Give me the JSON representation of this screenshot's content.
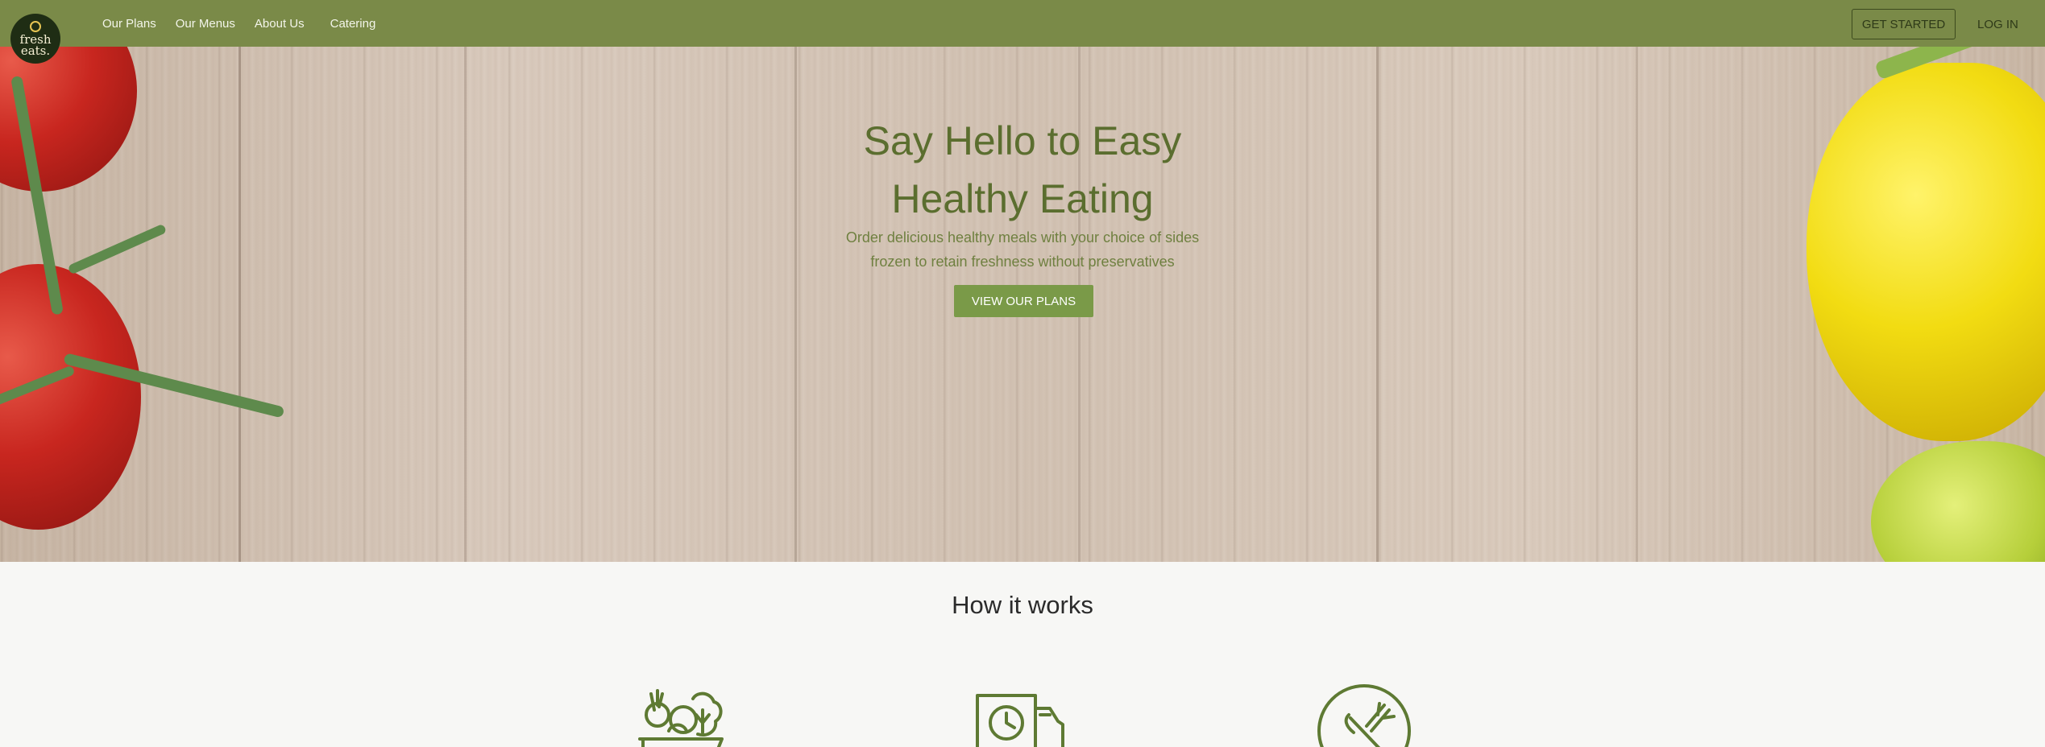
{
  "brand": {
    "logo_text_1": "fresh",
    "logo_text_2": "eats."
  },
  "nav": {
    "items": [
      {
        "label": "Our Plans"
      },
      {
        "label": "Our Menus"
      },
      {
        "label": "About Us"
      },
      {
        "label": "Catering"
      }
    ],
    "get_started": "GET STARTED",
    "login": "LOG IN"
  },
  "hero": {
    "title_line_1": "Say Hello to Easy",
    "title_line_2": "Healthy Eating",
    "subtitle_line_1": "Order delicious healthy meals with your choice of sides",
    "subtitle_line_2": "frozen to retain freshness without preservatives",
    "cta": "VIEW OUR PLANS"
  },
  "how_it_works": {
    "title": "How it works",
    "steps": [
      {
        "icon": "vegetable-basket-icon"
      },
      {
        "icon": "delivery-truck-clock-icon"
      },
      {
        "icon": "plate-fork-knife-icon"
      }
    ]
  },
  "colors": {
    "nav_bg": "#7a8a48",
    "accent": "#7a9a48",
    "heading_green": "#5b6e2f",
    "logo_bg": "#1f2d14"
  }
}
